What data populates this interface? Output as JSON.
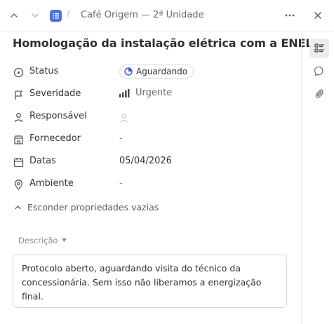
{
  "header": {
    "breadcrumb_separator": "/",
    "breadcrumb": "Café Origem — 2ª Unidade"
  },
  "task": {
    "title": "Homologação da instalação elétrica com a ENEL"
  },
  "properties": {
    "status": {
      "label": "Status",
      "value": "Aguardando"
    },
    "severity": {
      "label": "Severidade",
      "value": "Urgente"
    },
    "assignee": {
      "label": "Responsável"
    },
    "supplier": {
      "label": "Fornecedor",
      "value": "-"
    },
    "dates": {
      "label": "Datas",
      "value": "05/04/2026"
    },
    "environment": {
      "label": "Ambiente",
      "value": "-"
    }
  },
  "toggle_empty_label": "Esconder propriedades vazias",
  "description": {
    "label": "Descrição",
    "text": "Protocolo aberto, aguardando visita do técnico da concessionária. Sem isso não liberamos a energização final."
  },
  "colors": {
    "accent": "#4f6fe6",
    "status_icon": "#3b5bdb"
  },
  "icons": {
    "prev": "chevron-up-icon",
    "next": "chevron-down-icon",
    "list": "list-icon",
    "more": "more-horizontal-icon",
    "close": "close-icon",
    "properties_tab": "list-details-icon",
    "comments_tab": "comment-icon",
    "attachments_tab": "paperclip-icon"
  }
}
